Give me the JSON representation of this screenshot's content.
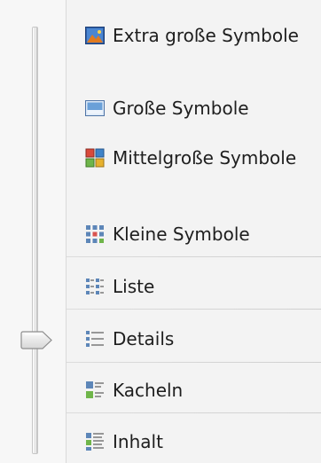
{
  "view_menu": {
    "items": [
      {
        "label": "Extra große Symbole",
        "icon": "extra-large-icons-icon"
      },
      {
        "label": "Große Symbole",
        "icon": "large-icons-icon"
      },
      {
        "label": "Mittelgroße Symbole",
        "icon": "medium-icons-icon"
      },
      {
        "label": "Kleine Symbole",
        "icon": "small-icons-icon"
      },
      {
        "label": "Liste",
        "icon": "list-view-icon"
      },
      {
        "label": "Details",
        "icon": "details-view-icon"
      },
      {
        "label": "Kacheln",
        "icon": "tiles-view-icon"
      },
      {
        "label": "Inhalt",
        "icon": "content-view-icon"
      }
    ],
    "selected_label": "Details"
  }
}
